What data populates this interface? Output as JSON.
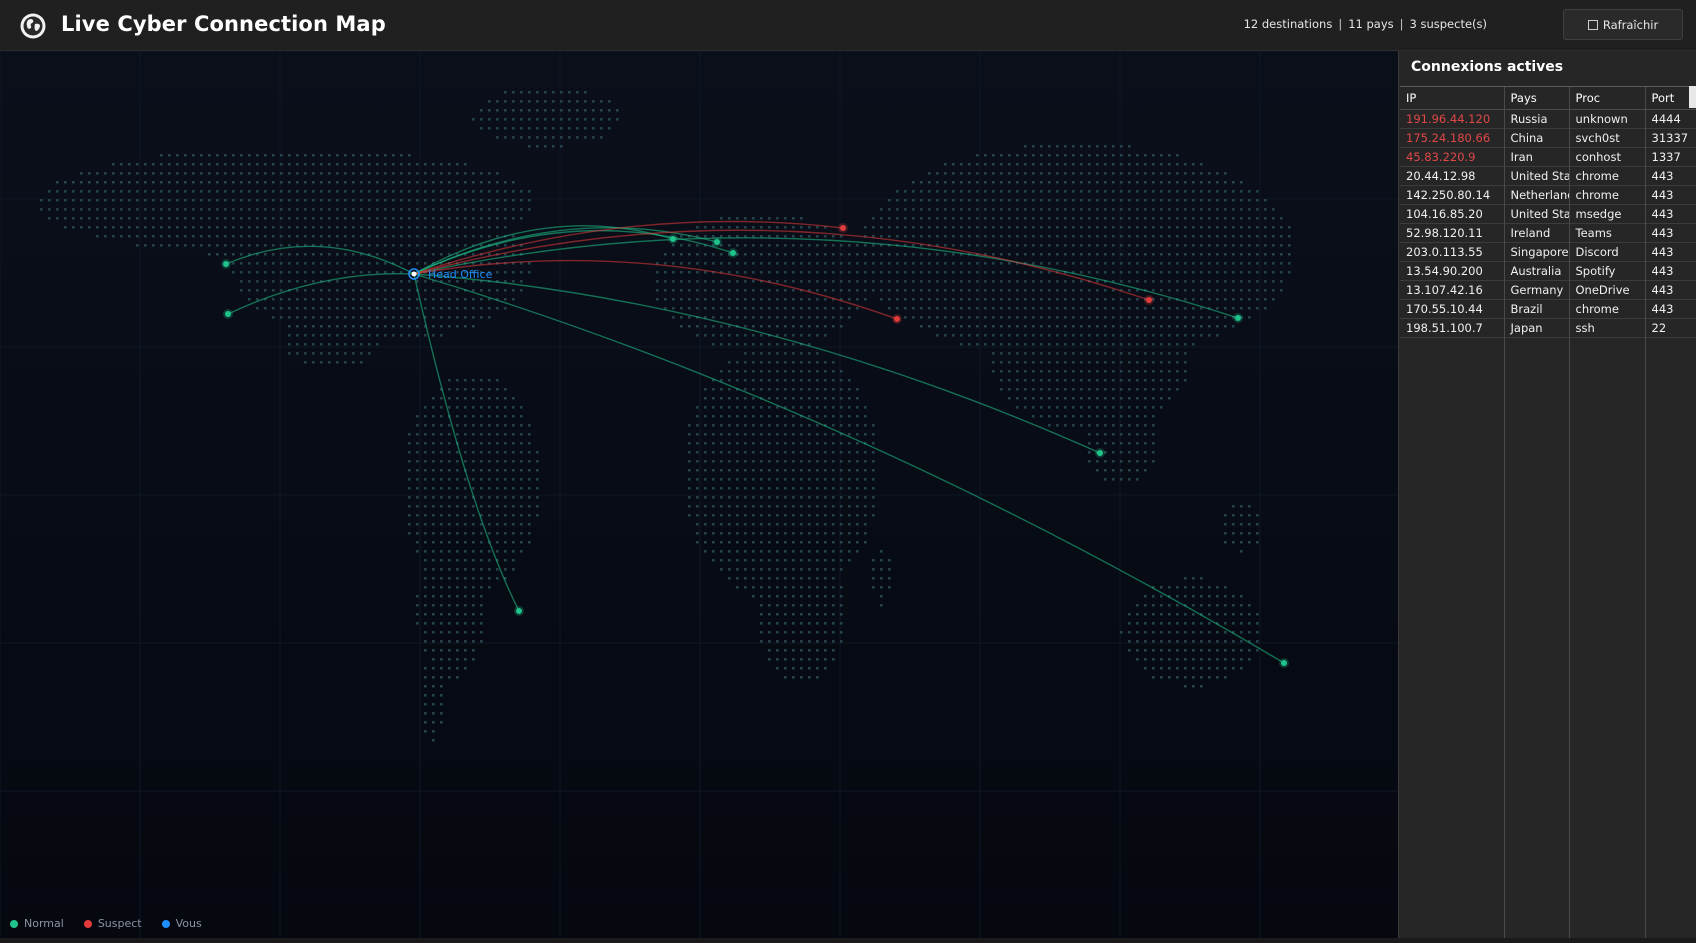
{
  "app": {
    "title": "Live Cyber Connection Map"
  },
  "stats": {
    "destinations": "12 destinations",
    "countries": "11 pays",
    "suspects": "3 suspecte(s)",
    "separator": "|"
  },
  "toolbar": {
    "refresh_label": "Rafraîchir"
  },
  "map": {
    "origin_label": "Head Office",
    "colors": {
      "normal": "#1fc48a",
      "suspect": "#e23b3b",
      "you": "#1e8fff",
      "dots": "#2a4c56"
    }
  },
  "legend": {
    "normal": "Normal",
    "suspect": "Suspect",
    "you": "Vous"
  },
  "panel": {
    "title": "Connexions actives",
    "columns": [
      "IP",
      "Pays",
      "Proc",
      "Port"
    ],
    "rows": [
      {
        "ip": "191.96.44.120",
        "country": "Russia",
        "proc": "unknown",
        "port": "4444",
        "suspect": true
      },
      {
        "ip": "175.24.180.66",
        "country": "China",
        "proc": "svch0st",
        "port": "31337",
        "suspect": true
      },
      {
        "ip": "45.83.220.9",
        "country": "Iran",
        "proc": "conhost",
        "port": "1337",
        "suspect": true
      },
      {
        "ip": "20.44.12.98",
        "country": "United Stat",
        "proc": "chrome",
        "port": "443",
        "suspect": false
      },
      {
        "ip": "142.250.80.14",
        "country": "Netherland",
        "proc": "chrome",
        "port": "443",
        "suspect": false
      },
      {
        "ip": "104.16.85.20",
        "country": "United Stat",
        "proc": "msedge",
        "port": "443",
        "suspect": false
      },
      {
        "ip": "52.98.120.11",
        "country": "Ireland",
        "proc": "Teams",
        "port": "443",
        "suspect": false
      },
      {
        "ip": "203.0.113.55",
        "country": "Singapore",
        "proc": "Discord",
        "port": "443",
        "suspect": false
      },
      {
        "ip": "13.54.90.200",
        "country": "Australia",
        "proc": "Spotify",
        "port": "443",
        "suspect": false
      },
      {
        "ip": "13.107.42.16",
        "country": "Germany",
        "proc": "OneDrive",
        "port": "443",
        "suspect": false
      },
      {
        "ip": "170.55.10.44",
        "country": "Brazil",
        "proc": "chrome",
        "port": "443",
        "suspect": false
      },
      {
        "ip": "198.51.100.7",
        "country": "Japan",
        "proc": "ssh",
        "port": "22",
        "suspect": false
      }
    ]
  }
}
